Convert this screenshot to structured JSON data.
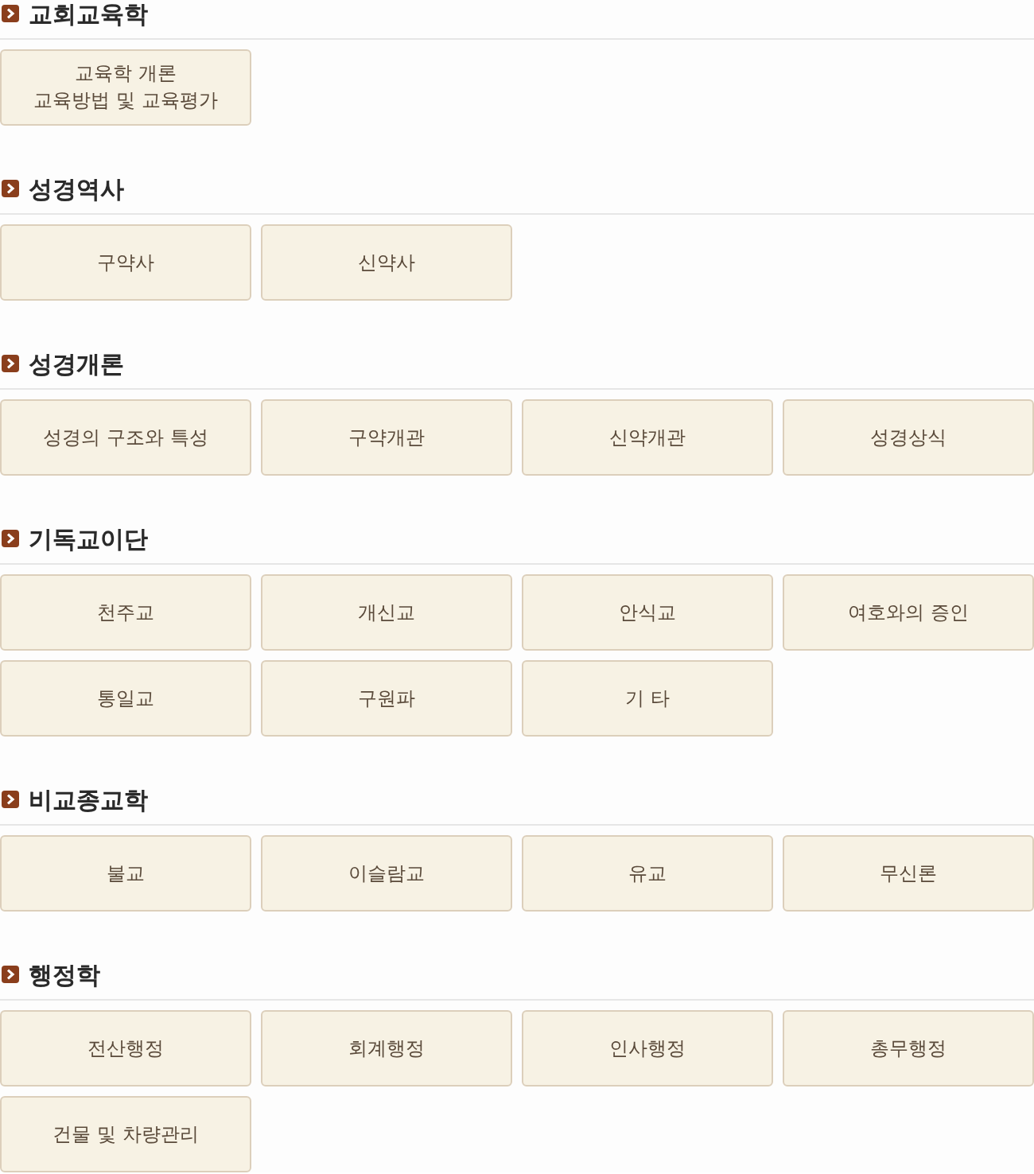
{
  "sections": [
    {
      "title": "교회교육학",
      "items": [
        "교육학 개론\n교육방법 및 교육평가"
      ]
    },
    {
      "title": "성경역사",
      "items": [
        "구약사",
        "신약사"
      ]
    },
    {
      "title": "성경개론",
      "items": [
        "성경의 구조와 특성",
        "구약개관",
        "신약개관",
        "성경상식"
      ]
    },
    {
      "title": "기독교이단",
      "items": [
        "천주교",
        "개신교",
        "안식교",
        "여호와의 증인",
        "통일교",
        "구원파",
        "기 타"
      ]
    },
    {
      "title": "비교종교학",
      "items": [
        "불교",
        "이슬람교",
        "유교",
        "무신론"
      ]
    },
    {
      "title": "행정학",
      "items": [
        "전산행정",
        "회계행정",
        "인사행정",
        "총무행정",
        "건물 및 차량관리"
      ]
    }
  ]
}
